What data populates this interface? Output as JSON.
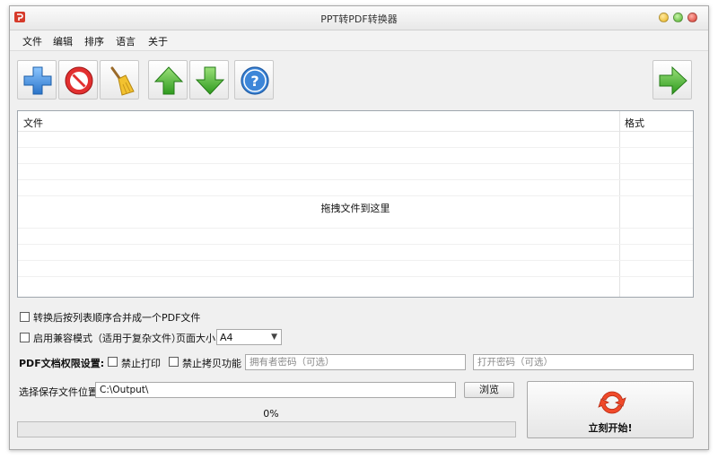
{
  "window": {
    "title": "PPT转PDF转换器"
  },
  "menu": [
    "文件",
    "编辑",
    "排序",
    "语言",
    "关于"
  ],
  "toolbar": {
    "buttons": [
      "add-icon",
      "remove-icon",
      "clear-broom-icon",
      "move-up-icon",
      "move-down-icon",
      "help-icon"
    ],
    "next_button": "next-arrow-icon"
  },
  "filelist": {
    "columns": [
      "文件",
      "格式"
    ],
    "empty_hint": "拖拽文件到这里"
  },
  "options": {
    "merge_label": "转换后按列表顺序合并成一个PDF文件",
    "merge_checked": false,
    "compat_label": "启用兼容模式（适用于复杂文件）",
    "compat_checked": false,
    "page_size_label": "页面大小",
    "page_size_value": "A4"
  },
  "permissions": {
    "label": "PDF文档权限设置:",
    "no_print_label": "禁止打印",
    "no_print_checked": false,
    "no_copy_label": "禁止拷贝功能",
    "no_copy_checked": false,
    "owner_password_placeholder": "拥有者密码（可选）",
    "open_password_placeholder": "打开密码（可选）"
  },
  "output": {
    "label": "选择保存文件位置",
    "path": "C:\\Output\\",
    "browse_label": "浏览"
  },
  "progress": {
    "text": "0%",
    "value": 0
  },
  "start": {
    "label": "立刻开始!"
  },
  "colors": {
    "progress": "#06b025",
    "accent_green": "#3cb52a",
    "accent_blue": "#2f7fd6",
    "stop_red": "#d82222"
  }
}
